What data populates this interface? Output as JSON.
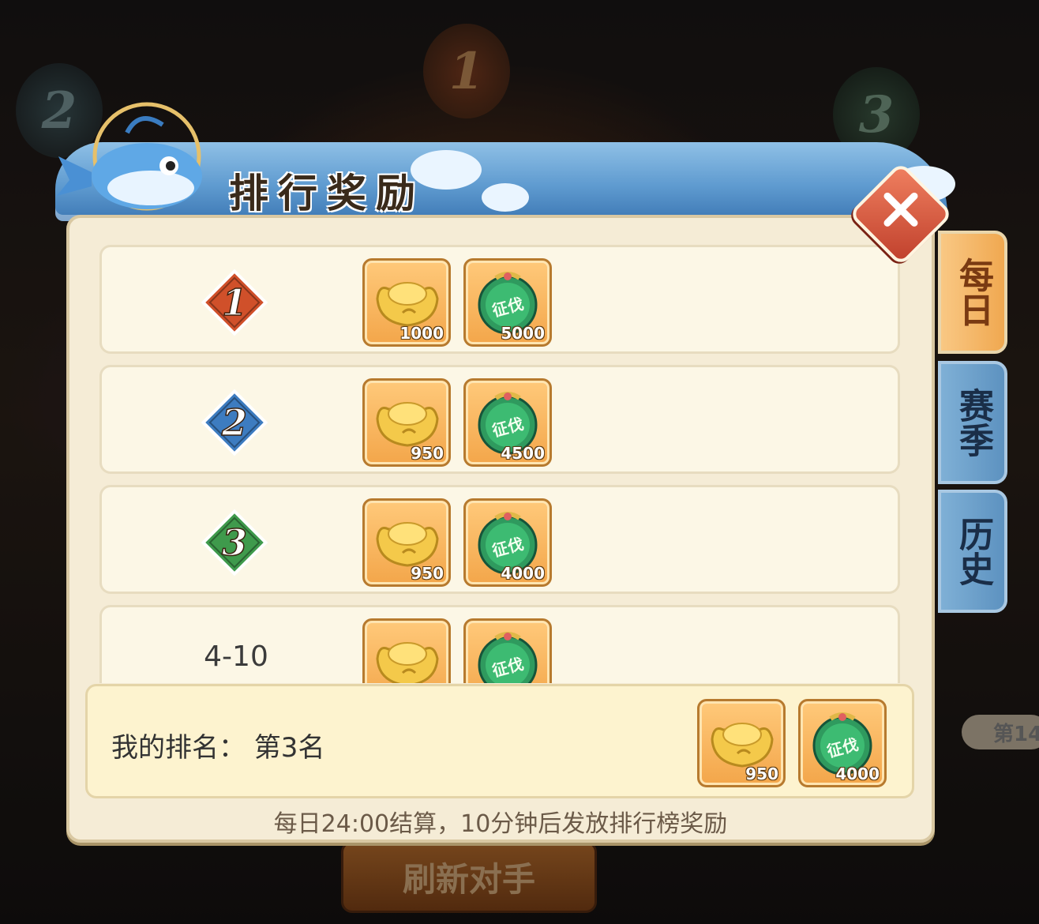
{
  "background": {
    "refresh_button": "刷新对手",
    "side_rank_text": "第14"
  },
  "header": {
    "title": "排行奖励"
  },
  "tabs": [
    {
      "label": "每日",
      "active": true
    },
    {
      "label": "赛季",
      "active": false
    },
    {
      "label": "历史",
      "active": false
    }
  ],
  "rewards": [
    {
      "rank": "1",
      "items": [
        {
          "icon": "gold-ingot-icon",
          "count": "1000"
        },
        {
          "icon": "conquest-token-icon",
          "count": "5000"
        }
      ]
    },
    {
      "rank": "2",
      "items": [
        {
          "icon": "gold-ingot-icon",
          "count": "950"
        },
        {
          "icon": "conquest-token-icon",
          "count": "4500"
        }
      ]
    },
    {
      "rank": "3",
      "items": [
        {
          "icon": "gold-ingot-icon",
          "count": "950"
        },
        {
          "icon": "conquest-token-icon",
          "count": "4000"
        }
      ]
    },
    {
      "rank": "4-10",
      "items": [
        {
          "icon": "gold-ingot-icon",
          "count": ""
        },
        {
          "icon": "conquest-token-icon",
          "count": ""
        }
      ]
    }
  ],
  "my_rank": {
    "label": "我的排名：  第3名",
    "items": [
      {
        "icon": "gold-ingot-icon",
        "count": "950"
      },
      {
        "icon": "conquest-token-icon",
        "count": "4000"
      }
    ]
  },
  "footer_note": "每日24:00结算，10分钟后发放排行榜奖励",
  "colors": {
    "rank1": "#d0502a",
    "rank2": "#3d7cc0",
    "rank3": "#3f9a4c",
    "panel_bg": "#f5ecd6",
    "item_bg": "#f3a64a"
  },
  "token_glyph": "征伐"
}
